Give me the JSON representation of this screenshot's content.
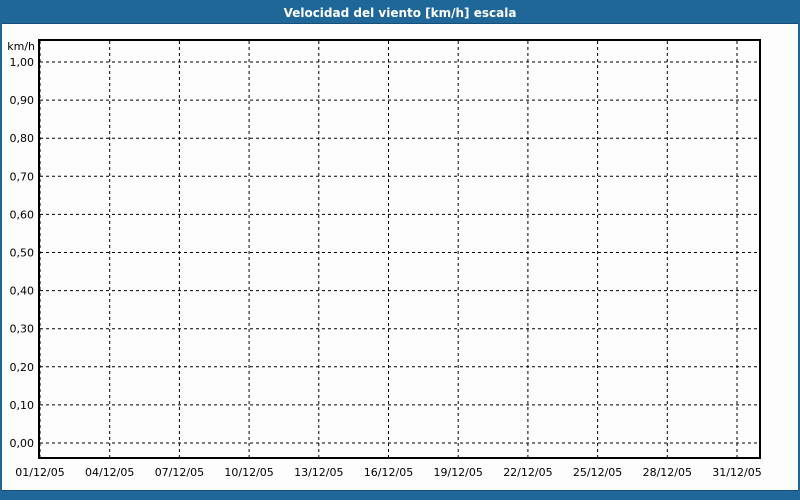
{
  "window": {
    "title": "Velocidad del viento [km/h] escala"
  },
  "colors": {
    "accent": "#1F6699",
    "accent_dark_edge": "#154F7A",
    "plot_border": "#000000",
    "grid": "#000000",
    "axis_text": "#000000",
    "title_text": "#FFFFFF",
    "background": "#FDFDFD"
  },
  "chart_data": {
    "type": "line",
    "title": "Velocidad del viento [km/h] escala",
    "ylabel": "km/h",
    "xlabel": "",
    "ylim": [
      0.0,
      1.0
    ],
    "y_tick_step": 0.1,
    "y_tick_labels": [
      "1,00",
      "0,90",
      "0,80",
      "0,70",
      "0,60",
      "0,50",
      "0,40",
      "0,30",
      "0,20",
      "0,10",
      "0,00"
    ],
    "x_tick_labels": [
      "01/12/05",
      "04/12/05",
      "07/12/05",
      "10/12/05",
      "13/12/05",
      "16/12/05",
      "19/12/05",
      "22/12/05",
      "25/12/05",
      "28/12/05",
      "31/12/05"
    ],
    "series": [],
    "grid": "dashed",
    "grid_on": true,
    "legend_position": "none"
  }
}
